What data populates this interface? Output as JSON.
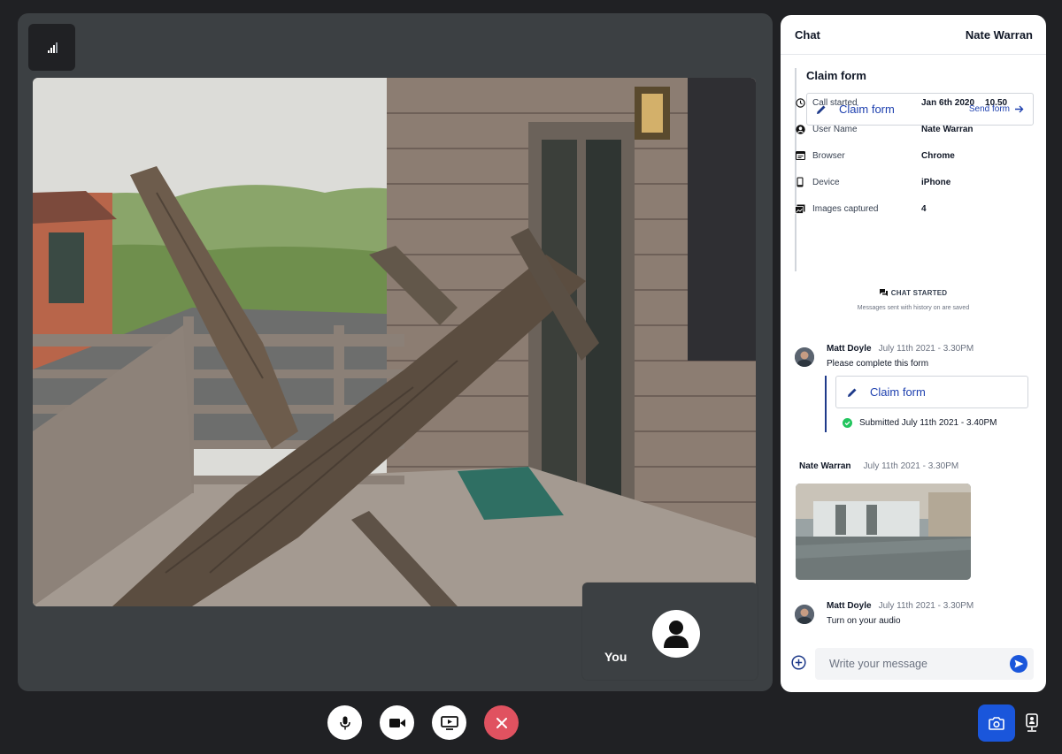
{
  "you_label": "You",
  "chat": {
    "title": "Chat",
    "user_name": "Nate Warran",
    "claim_heading": "Claim form",
    "claim_card_name": "Claim form",
    "send_form_label": "Send form",
    "info": [
      {
        "label": "Call started",
        "value": "Jan 6th 2020",
        "value2": "10.50",
        "icon": "clock-icon"
      },
      {
        "label": "User Name",
        "value": "Nate Warran",
        "icon": "user-circle-icon"
      },
      {
        "label": "Browser",
        "value": "Chrome",
        "icon": "browser-icon"
      },
      {
        "label": "Device",
        "value": "iPhone",
        "icon": "phone-icon"
      },
      {
        "label": "Images captured",
        "value": "4",
        "icon": "images-icon"
      }
    ],
    "chat_started": "CHAT STARTED",
    "chat_started_note": "Messages sent with history on are saved",
    "messages": [
      {
        "author": "Matt Doyle",
        "time": "July 11th 2021 - 3.30PM",
        "text": "Please complete this form"
      },
      {
        "author": "Nate Warran",
        "time": "July 11th 2021 - 3.30PM"
      },
      {
        "author": "Matt Doyle",
        "time": "July 11th 2021 - 3.30PM",
        "text": "Turn on your audio"
      }
    ],
    "form_reply_name": "Claim form",
    "submitted_text": "Submitted July 11th 2021 - 3.40PM",
    "composer_placeholder": "Write your message"
  },
  "colors": {
    "background": "#202124",
    "stage": "#3c4043",
    "accent": "#1a56db",
    "end_call": "#e05260",
    "success": "#22c55e"
  },
  "icons": {
    "signal": "signal-bars-icon",
    "mic": "microphone-icon",
    "video": "video-camera-icon",
    "screen": "screen-share-icon",
    "end": "close-icon",
    "capture": "camera-icon",
    "device": "device-icon"
  }
}
